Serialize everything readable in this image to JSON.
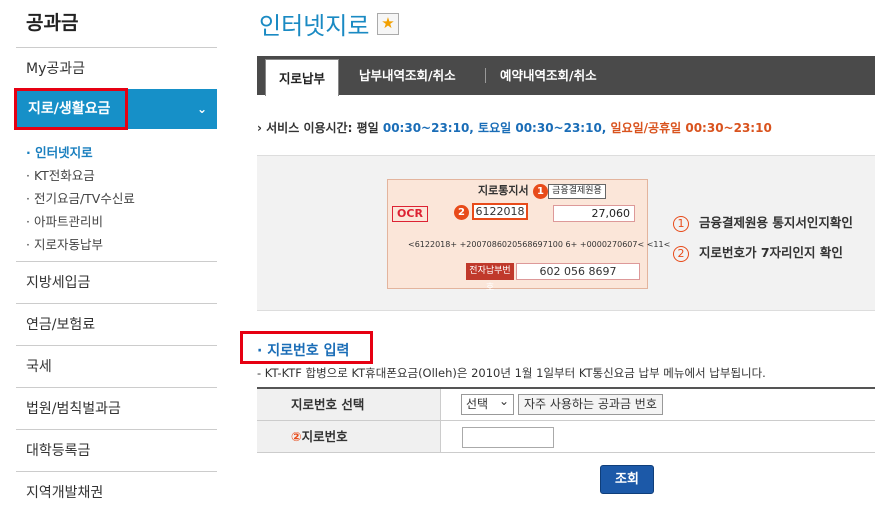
{
  "sidebar": {
    "title": "공과금",
    "items": [
      "My공과금",
      "지방세입금",
      "연금/보험료",
      "국세",
      "법원/범칙벌과금",
      "대학등록금",
      "지역개발채권"
    ],
    "active_item": "지로/생활요금",
    "sub_items": [
      "· 인터넷지로",
      "· KT전화요금",
      "· 전기요금/TV수신료",
      "· 아파트관리비",
      "· 지로자동납부"
    ]
  },
  "header": {
    "title": "인터넷지로",
    "star_icon": "star-icon"
  },
  "tabs": {
    "active": "지로납부",
    "others": [
      "납부내역조회/취소",
      "예약내역조회/취소"
    ]
  },
  "service_hours": {
    "prefix": "서비스 이용시간: 평일 ",
    "weekday": "00:30~23:10,",
    "saturday_label": " 토요일 ",
    "saturday": "00:30~23:10,",
    "holiday_label": " 일요일/공휴일 ",
    "holiday": "00:30~23:10"
  },
  "slip": {
    "header": "지로통지서",
    "box1": "금융결제원용",
    "ocr": "OCR",
    "giro_number": "6122018",
    "amount": "27,060",
    "code_line": "<6122018+ +2007086020568697100 6+ +0000270607< <11<",
    "payer_label": "전자납부번호",
    "payer_number": "602 056 8697",
    "badge1": "1",
    "badge2": "2"
  },
  "notes": [
    {
      "num": "1",
      "text": "금융결제원용 통지서인지확인"
    },
    {
      "num": "2",
      "text": "지로번호가 7자리인지 확인"
    }
  ],
  "section": {
    "title": "· 지로번호 입력",
    "notice": "- KT-KTF 합병으로 KT휴대폰요금(Olleh)은 2010년 1월 1일부터 KT통신요금 납부 메뉴에서 납부됩니다."
  },
  "form": {
    "row1_label": "지로번호 선택",
    "select_value": "선택",
    "fav_button": "자주 사용하는 공과금 번호",
    "row2_num": "②",
    "row2_label": "지로번호",
    "input_value": "",
    "submit": "조회"
  },
  "colors": {
    "accent": "#1690c8",
    "highlight_box": "#e60012",
    "tab_bar": "#4a4a4a",
    "submit": "#1c59a8"
  }
}
